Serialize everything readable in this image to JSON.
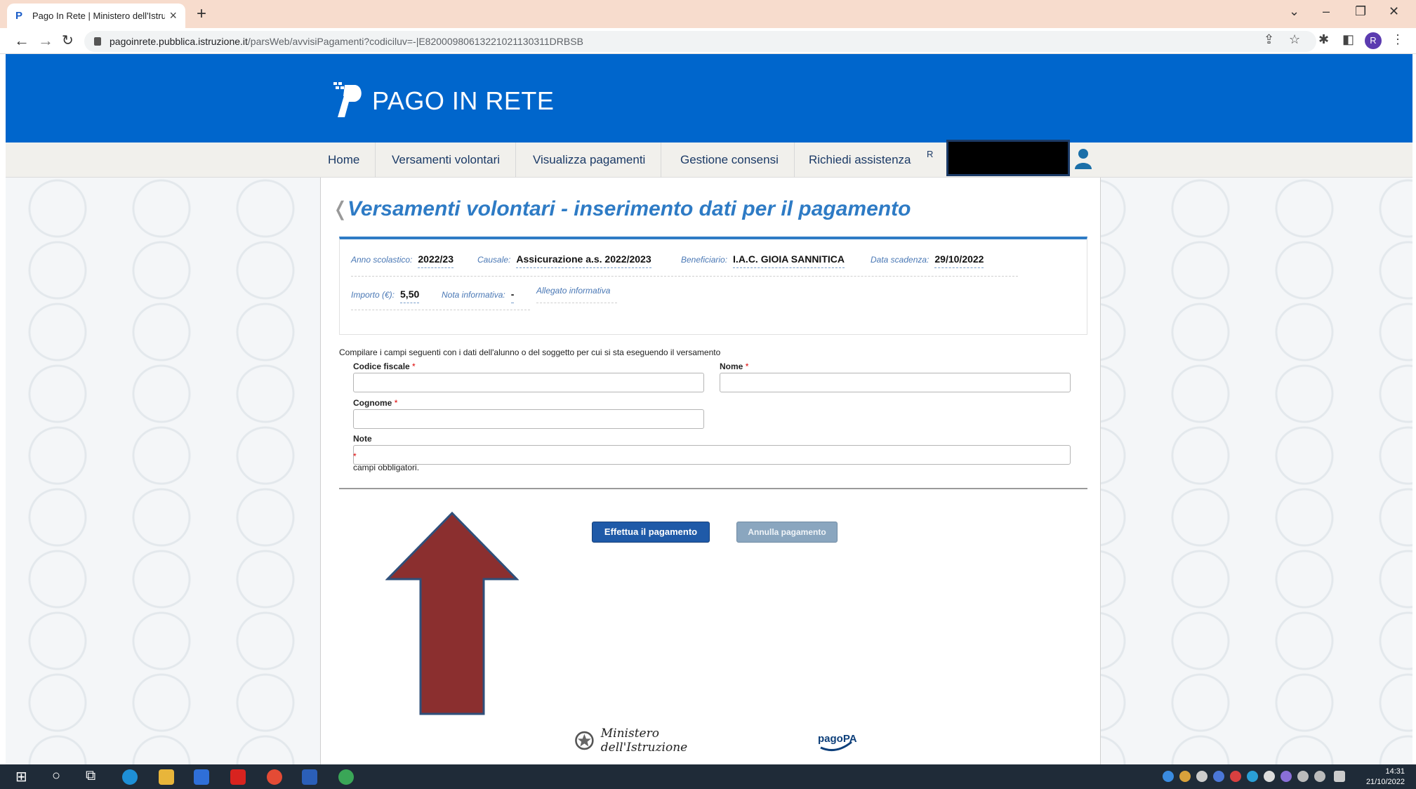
{
  "browser": {
    "tab_title": "Pago In Rete | Ministero dell'Istru",
    "tab_close": "×",
    "new_tab": "+",
    "url_host": "pagoinrete.pubblica.istruzione.it",
    "url_path": "/parsWeb/avvisiPagamenti?codiciluv=-|E82000980613221021130311DRBSB",
    "profile_initial": "R"
  },
  "site": {
    "logo": "PAGO IN RETE",
    "nav": [
      "Home",
      "Versamenti volontari",
      "Visualizza pagamenti",
      "Gestione consensi",
      "Richiedi assistenza"
    ],
    "nav_partial": "R"
  },
  "page": {
    "title": "Versamenti volontari - inserimento dati per il pagamento",
    "info": {
      "anno_label": "Anno scolastico:",
      "anno_value": "2022/23",
      "causale_label": "Causale:",
      "causale_value": "Assicurazione a.s. 2022/2023",
      "beneficiario_label": "Beneficiario:",
      "beneficiario_value": "I.A.C. GIOIA SANNITICA",
      "scadenza_label": "Data scadenza:",
      "scadenza_value": "29/10/2022",
      "importo_label": "Importo (€):",
      "importo_value": "5,50",
      "nota_label": "Nota informativa:",
      "nota_value": "-",
      "allegato_label": "Allegato informativa"
    },
    "instructions": "Compilare i campi seguenti con i dati dell'alunno o del soggetto per cui si sta eseguendo il versamento",
    "form": {
      "codice_fiscale": "Codice fiscale",
      "nome": "Nome",
      "cognome": "Cognome",
      "note": "Note",
      "required_mark": "*",
      "mandatory_note": "campi obbligatori."
    },
    "buttons": {
      "pay": "Effettua il pagamento",
      "cancel": "Annulla pagamento"
    },
    "footer": {
      "ministero": "Ministero dell'Istruzione",
      "pagopa": "pagoPA"
    }
  },
  "taskbar": {
    "time": "14:31",
    "date": "21/10/2022"
  },
  "colors": {
    "header_blue": "#0066cc",
    "title_blue": "#2e7bc5",
    "pay_button": "#1f5aa8",
    "arrow_fill": "#8b2f2f",
    "arrow_stroke": "#2f4f7a"
  }
}
